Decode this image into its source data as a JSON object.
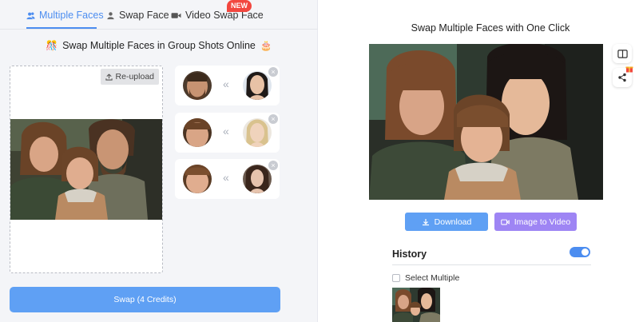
{
  "tabs": [
    {
      "label": "Multiple Faces",
      "icon": "users-icon",
      "active": true
    },
    {
      "label": "Swap Face",
      "icon": "user-icon",
      "active": false
    },
    {
      "label": "Video Swap Face",
      "icon": "video-camera-icon",
      "active": false,
      "badge": "NEW"
    }
  ],
  "left": {
    "title": "Swap Multiple Faces in Group Shots Online",
    "title_emoji_left": "🎊",
    "title_emoji_right": "🎂",
    "reupload_label": "Re-upload",
    "swap_button_label": "Swap (4 Credits)",
    "face_pairs": [
      {
        "source": "bearded-man-face",
        "target": "asian-woman-face"
      },
      {
        "source": "woman-face",
        "target": "blonde-woman-face"
      },
      {
        "source": "child-face",
        "target": "dark-haired-woman-face"
      }
    ],
    "arrow_glyph": "«",
    "close_glyph": "×"
  },
  "right": {
    "title": "Swap Multiple Faces with One Click",
    "download_label": "Download",
    "video_label": "Image to Video",
    "history_title": "History",
    "history_toggle_on": true,
    "select_multiple_label": "Select Multiple"
  },
  "colors": {
    "accent": "#4c8df0",
    "button_blue": "#5fa0f4",
    "button_purple": "#9e85f4",
    "new_badge": "#f2473f"
  }
}
